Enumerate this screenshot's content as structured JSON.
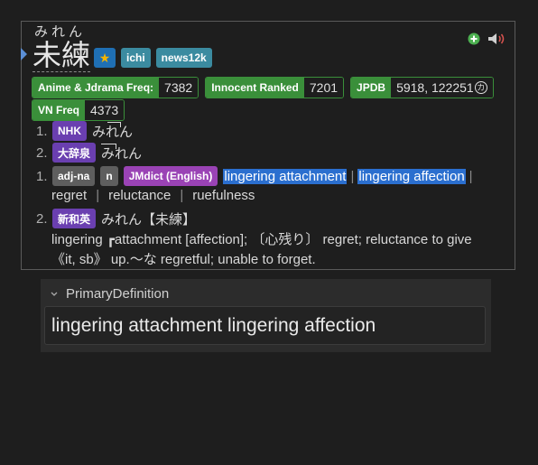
{
  "entry": {
    "furigana": "みれん",
    "kanji": "未練",
    "head_tags": [
      "ichi",
      "news12k"
    ],
    "frequencies": [
      {
        "label": "Anime & Jdrama Freq:",
        "value": "7382"
      },
      {
        "label": "Innocent Ranked",
        "value": "7201"
      },
      {
        "label": "JPDB",
        "value": "5918, 122251",
        "suffix": "カ"
      },
      {
        "label": "VN Freq",
        "value": "4373"
      }
    ],
    "pitch": [
      {
        "num": "1.",
        "source": "NHK",
        "reading": "みれん"
      },
      {
        "num": "2.",
        "source": "大辞泉",
        "reading": "みれん"
      }
    ],
    "definitions": [
      {
        "num": "1.",
        "tags": [
          "adj-na",
          "n",
          "JMdict (English)"
        ],
        "glosses": [
          "lingering attachment",
          "lingering affection",
          "regret",
          "reluctance",
          "ruefulness"
        ]
      },
      {
        "num": "2.",
        "dict": "新和英",
        "headline": "みれん【未練】",
        "line1": "lingering  ┏attachment [affection]; 〔心残り〕 regret; reluctance to give",
        "line2": "《it, sb》 up.〜な regretful; unable to forget."
      }
    ]
  },
  "panel": {
    "title": "PrimaryDefinition",
    "value": "lingering attachment lingering affection"
  },
  "colors": {
    "accent": "#2b6fcf",
    "freq": "#3a8f3a",
    "purple": "#6a3fb0"
  }
}
